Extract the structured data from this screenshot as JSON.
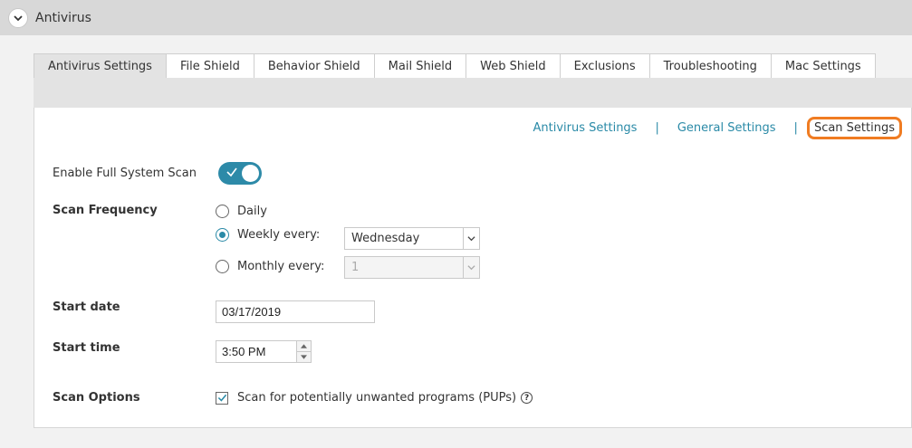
{
  "section": {
    "title": "Antivirus"
  },
  "tabs": [
    {
      "label": "Antivirus Settings",
      "active": true
    },
    {
      "label": "File Shield"
    },
    {
      "label": "Behavior Shield"
    },
    {
      "label": "Mail Shield"
    },
    {
      "label": "Web Shield"
    },
    {
      "label": "Exclusions"
    },
    {
      "label": "Troubleshooting"
    },
    {
      "label": "Mac Settings"
    }
  ],
  "subnav": {
    "antivirus_settings": "Antivirus Settings",
    "separator": "|",
    "general_settings": "General Settings",
    "scan_settings": "Scan Settings"
  },
  "form": {
    "enable_full_scan_label": "Enable Full System Scan",
    "enable_full_scan_on": true,
    "scan_frequency_label": "Scan Frequency",
    "freq_daily": "Daily",
    "freq_weekly": "Weekly every:",
    "freq_monthly": "Monthly every:",
    "selected_frequency": "weekly",
    "weekly_day": "Wednesday",
    "monthly_day": "1",
    "start_date_label": "Start date",
    "start_date": "03/17/2019",
    "start_time_label": "Start time",
    "start_time": "3:50 PM",
    "scan_options_label": "Scan Options",
    "pup_option": "Scan for potentially unwanted programs (PUPs)",
    "pup_checked": true,
    "help_symbol": "?"
  },
  "colors": {
    "accent": "#2a8aa7",
    "highlight": "#f07c22",
    "toggle": "#2d8aa8"
  }
}
